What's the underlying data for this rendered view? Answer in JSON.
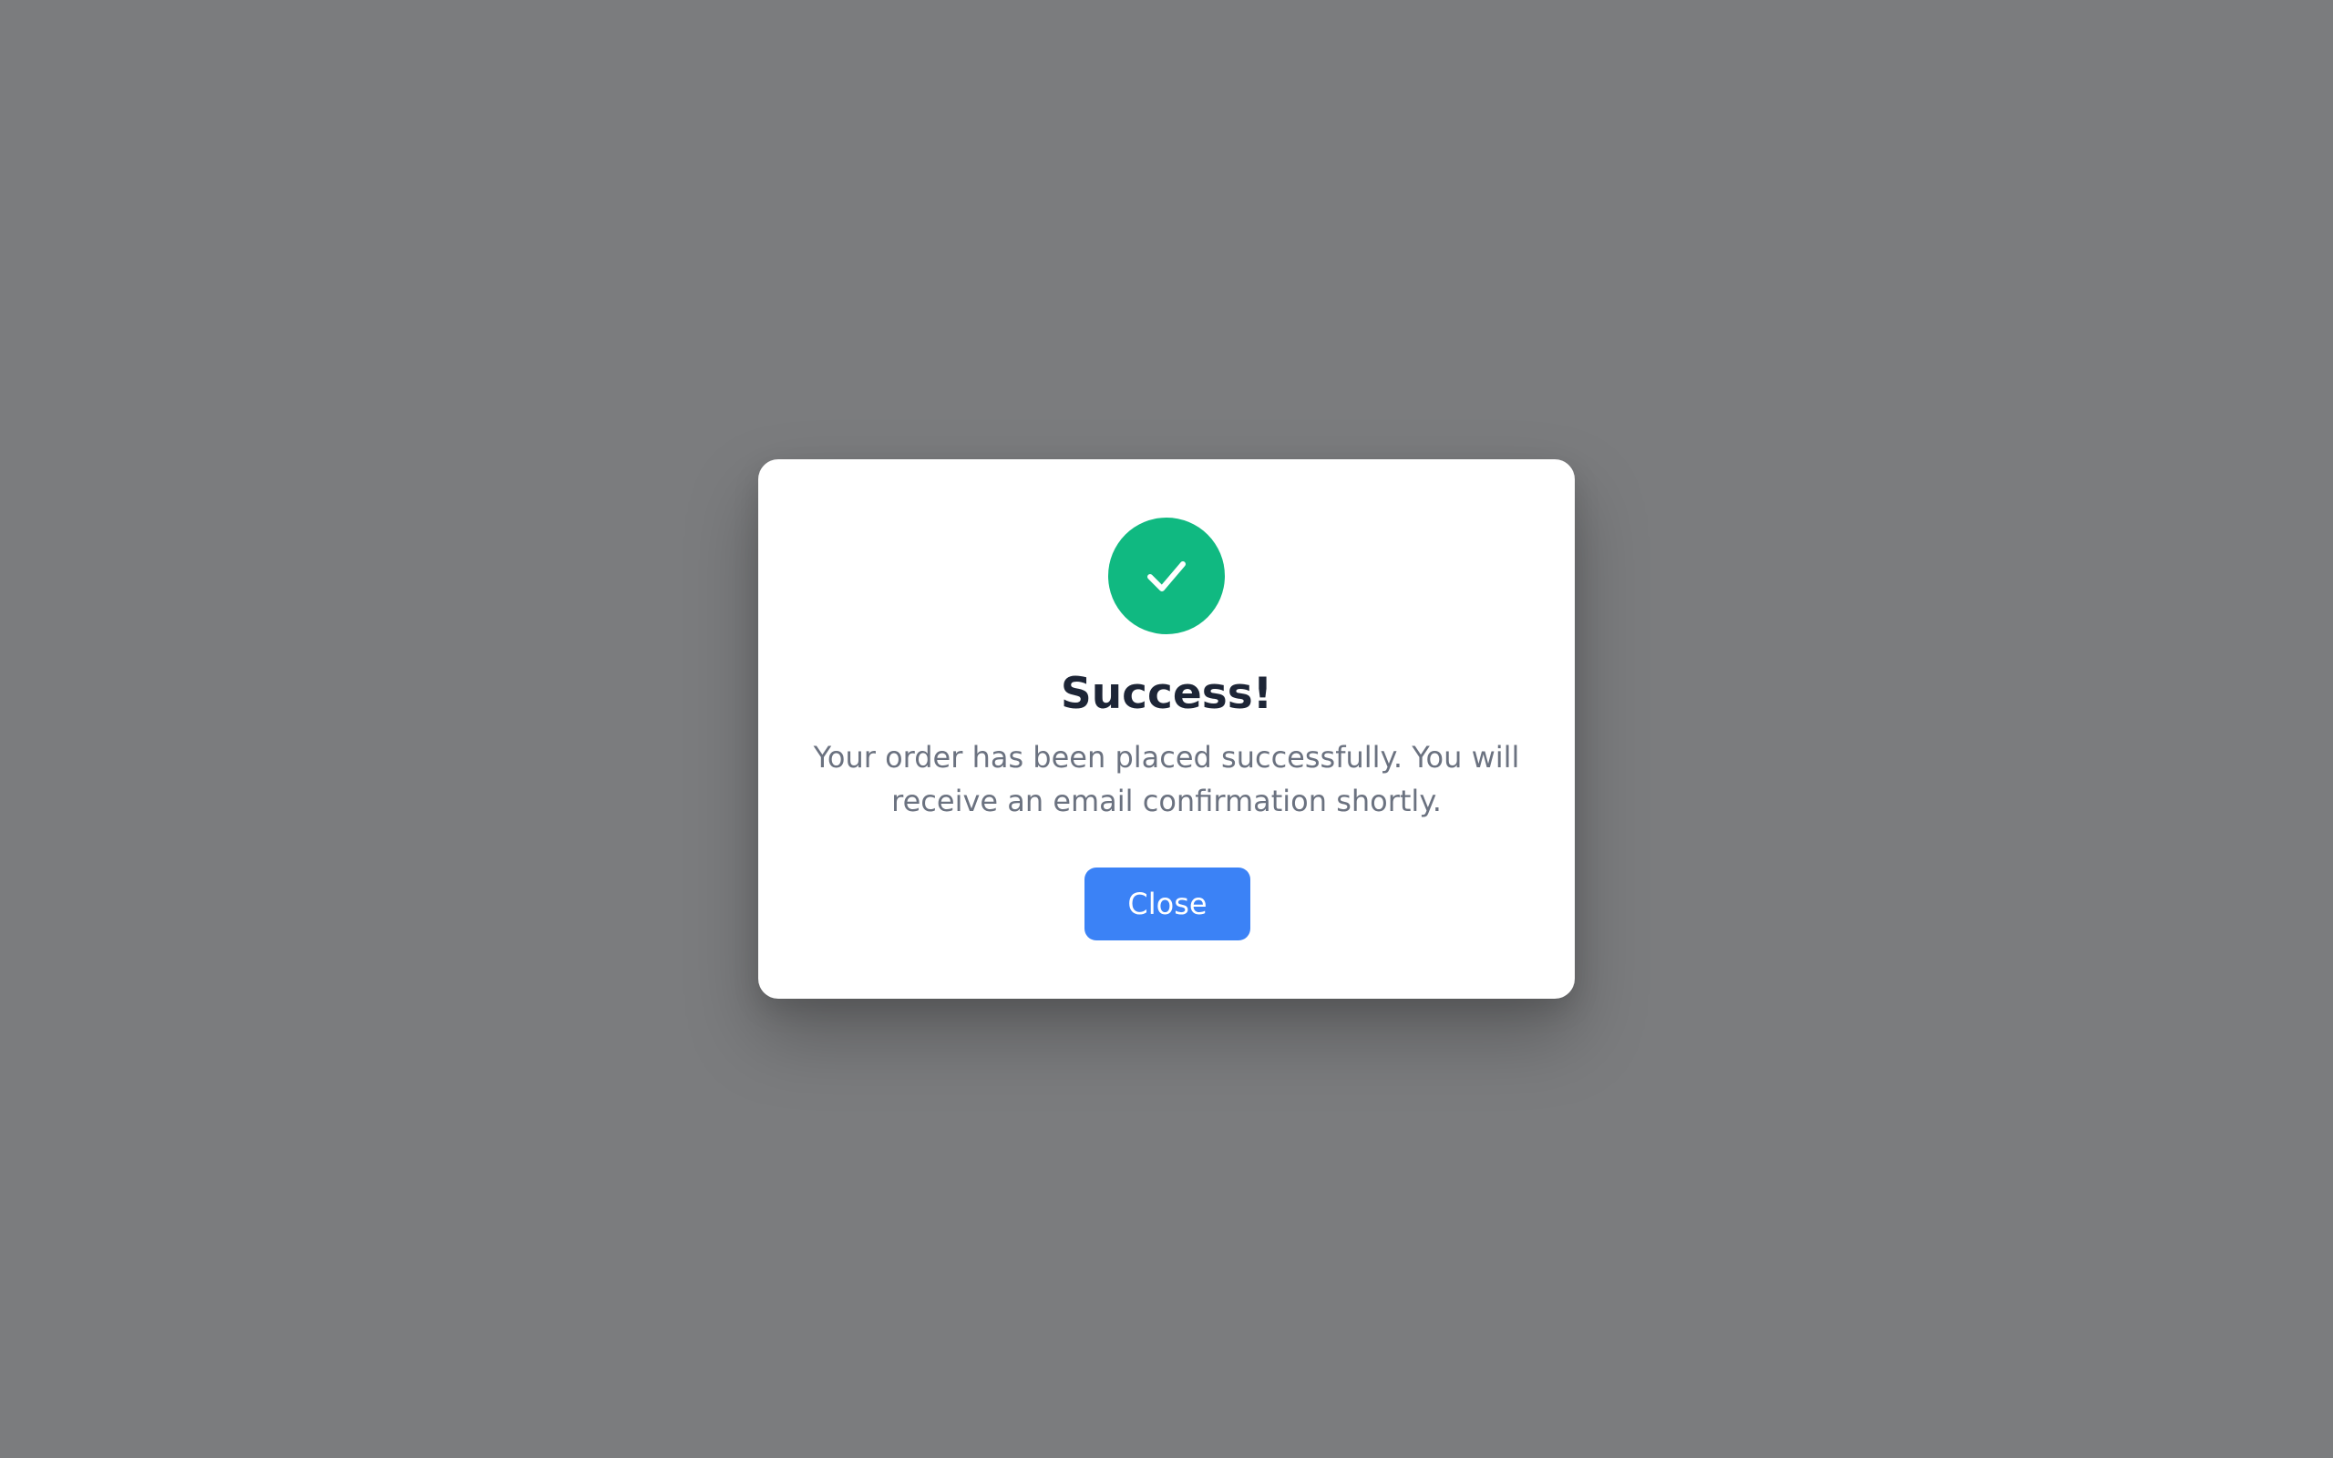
{
  "dialog": {
    "icon": "check-icon",
    "title": "Success!",
    "message": "Your order has been placed successfully. You will receive an email confirmation shortly.",
    "close_label": "Close"
  },
  "colors": {
    "backdrop": "#7b7c7e",
    "success": "#10b981",
    "primary_button": "#3b82f6",
    "title": "#1d2536",
    "message": "#6b7280"
  }
}
